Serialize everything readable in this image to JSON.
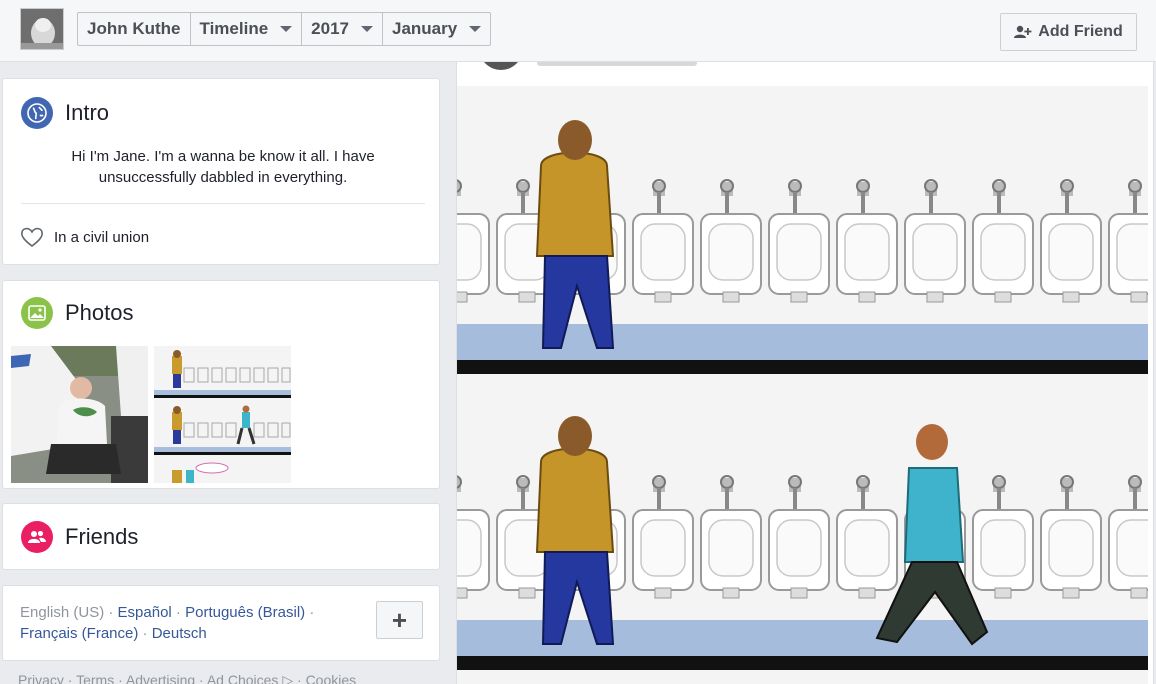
{
  "topbar": {
    "profile_name": "John Kuthe",
    "timeline_label": "Timeline",
    "year_label": "2017",
    "month_label": "January",
    "add_friend_label": "Add Friend"
  },
  "intro": {
    "title": "Intro",
    "bio": "Hi I'm Jane. I'm a wanna be know it all. I have unsuccessfully dabbled in everything.",
    "relationship": "In a civil union"
  },
  "photos": {
    "title": "Photos"
  },
  "friends": {
    "title": "Friends"
  },
  "languages": {
    "current": "English (US)",
    "links": [
      "Español",
      "Português (Brasil)",
      "Français (France)",
      "Deutsch"
    ],
    "add_label": "+"
  },
  "footer": {
    "links": [
      "Privacy",
      "Terms",
      "Advertising",
      "Ad Choices",
      "Cookies"
    ]
  },
  "colors": {
    "intro_icon": "#4267b2",
    "photos_icon": "#8bc34a",
    "friends_icon": "#e91e63",
    "link": "#365899"
  }
}
